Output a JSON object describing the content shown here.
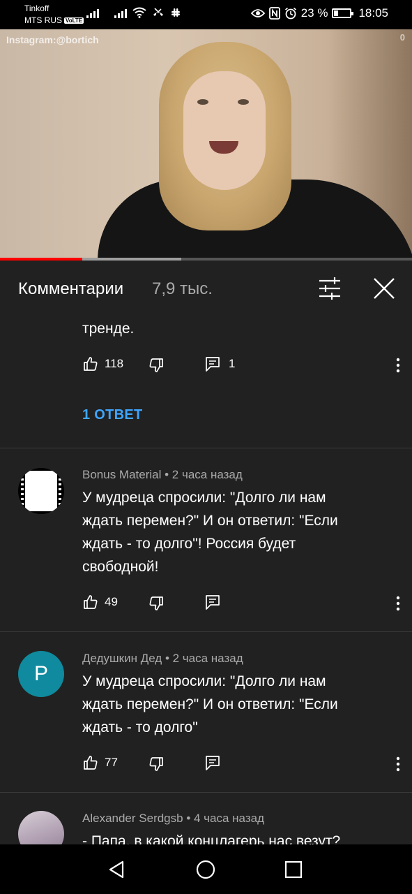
{
  "status_bar": {
    "carrier1": "Tinkoff",
    "carrier2": "MTS RUS",
    "volte": "VoLTE",
    "battery": "23 %",
    "battery_level": 0.23,
    "time": "18:05"
  },
  "video": {
    "watermark": "Instagram:@bortich",
    "corner_mark": "0",
    "progress_played": 0.2,
    "progress_buffered": 0.44
  },
  "comments_header": {
    "title": "Комментарии",
    "count": "7,9 тыс."
  },
  "comments": [
    {
      "text_tail": "тренде.",
      "likes": "118",
      "replies_count": "1",
      "replies_link": "1 ОТВЕТ"
    },
    {
      "author": "Bonus Material",
      "time": "2 часа назад",
      "text_lines": [
        "У мудреца спросили: \"Долго ли нам",
        "ждать перемен?\" И он ответил: \"Если",
        "ждать - то долго\"! Россия будет",
        "свободной!"
      ],
      "likes": "49"
    },
    {
      "author": "Дедушкин Дед",
      "time": "2 часа назад",
      "avatar_letter": "P",
      "text_lines": [
        "У мудреца спросили: \"Долго ли нам",
        "ждать перемен?\" И он ответил: \"Если",
        "ждать - то долго\""
      ],
      "likes": "77"
    },
    {
      "author": "Alexander Serdgsb",
      "time": "4 часа назад",
      "text_lines": [
        "- Папа, в какой концлагерь нас везут?"
      ]
    }
  ],
  "colors": {
    "background": "#212121",
    "accent_link": "#3ea6ff",
    "progress_red": "#ff0000",
    "avatar_teal": "#0f8a9e"
  },
  "icons": [
    "thumb-up-icon",
    "thumb-down-icon",
    "reply-icon",
    "more-vert-icon",
    "filter-icon",
    "close-icon",
    "back-icon",
    "home-icon",
    "recent-apps-icon"
  ]
}
